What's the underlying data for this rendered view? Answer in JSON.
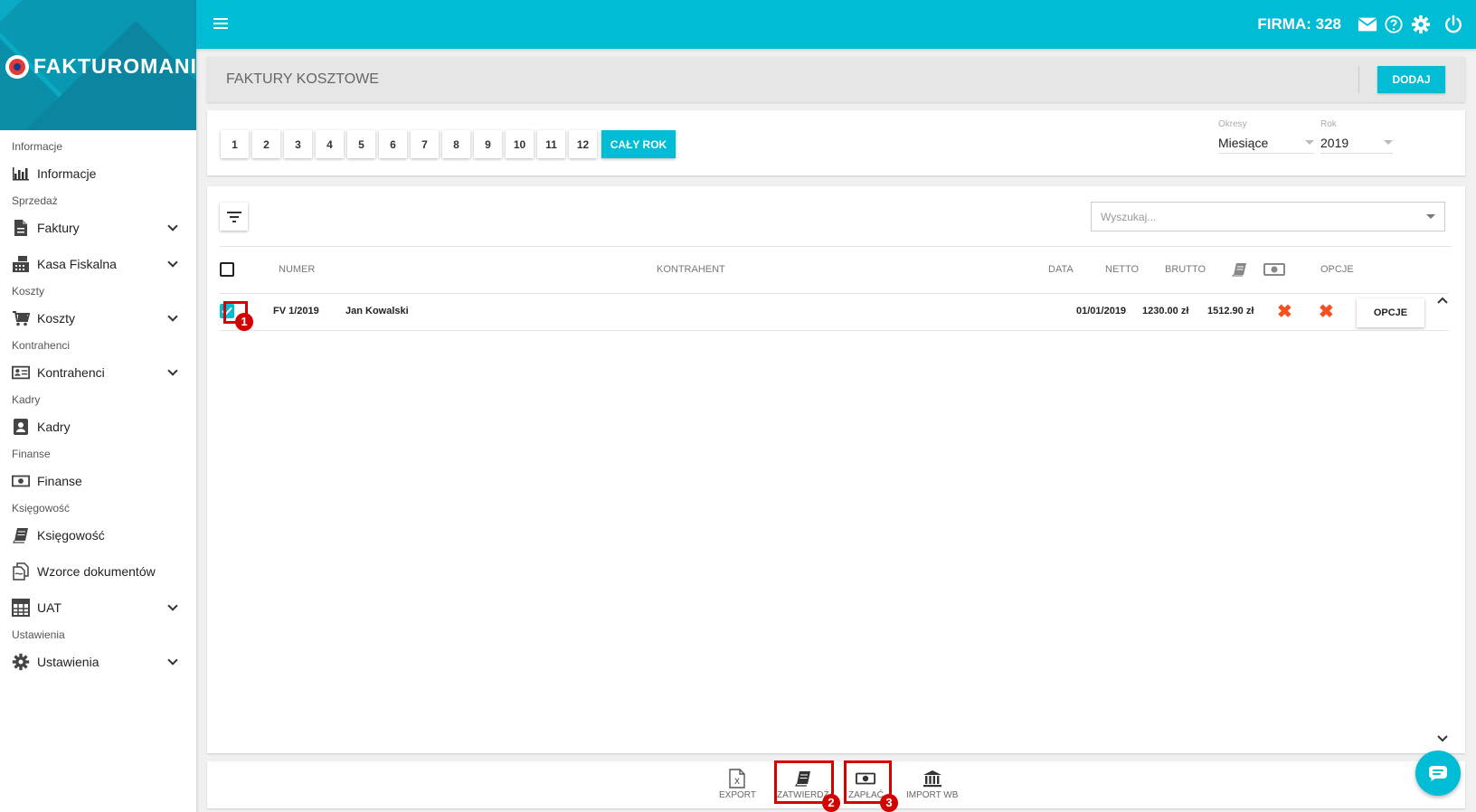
{
  "app": {
    "logo_text": "FAKTUROMANIA"
  },
  "topbar": {
    "firma_label": "FIRMA: 328"
  },
  "sidebar": {
    "items": [
      {
        "type": "section",
        "label": "Informacje"
      },
      {
        "type": "item",
        "label": "Informacje",
        "icon": "chart-bar-icon",
        "expandable": false
      },
      {
        "type": "section",
        "label": "Sprzedaż"
      },
      {
        "type": "item",
        "label": "Faktury",
        "icon": "document-icon",
        "expandable": true
      },
      {
        "type": "item",
        "label": "Kasa Fiskalna",
        "icon": "cash-register-icon",
        "expandable": true
      },
      {
        "type": "section",
        "label": "Koszty"
      },
      {
        "type": "item",
        "label": "Koszty",
        "icon": "cart-icon",
        "expandable": true
      },
      {
        "type": "section",
        "label": "Kontrahenci"
      },
      {
        "type": "item",
        "label": "Kontrahenci",
        "icon": "id-card-icon",
        "expandable": true
      },
      {
        "type": "section",
        "label": "Kadry"
      },
      {
        "type": "item",
        "label": "Kadry",
        "icon": "person-badge-icon",
        "expandable": false
      },
      {
        "type": "section",
        "label": "Finanse"
      },
      {
        "type": "item",
        "label": "Finanse",
        "icon": "money-icon",
        "expandable": false
      },
      {
        "type": "section",
        "label": "Księgowość"
      },
      {
        "type": "item",
        "label": "Księgowość",
        "icon": "ledger-book-icon",
        "expandable": false
      },
      {
        "type": "item",
        "label": "Wzorce dokumentów",
        "icon": "copy-docs-icon",
        "expandable": false
      },
      {
        "type": "item",
        "label": "UAT",
        "icon": "calculator-icon",
        "expandable": true
      },
      {
        "type": "section",
        "label": "Ustawienia"
      },
      {
        "type": "item",
        "label": "Ustawienia",
        "icon": "gear-icon",
        "expandable": true
      }
    ]
  },
  "header": {
    "title": "FAKTURY KOSZTOWE",
    "add_label": "DODAJ"
  },
  "periods": {
    "months": [
      "1",
      "2",
      "3",
      "4",
      "5",
      "6",
      "7",
      "8",
      "9",
      "10",
      "11",
      "12"
    ],
    "year_label": "CAŁY ROK",
    "okresy_label": "Okresy",
    "okresy_value": "Miesiące",
    "rok_label": "Rok",
    "rok_value": "2019"
  },
  "search": {
    "placeholder": "Wyszukaj..."
  },
  "table": {
    "headers": {
      "numer": "NUMER",
      "kontrahent": "KONTRAHENT",
      "data": "DATA",
      "netto": "NETTO",
      "brutto": "BRUTTO",
      "opcje": "OPCJE"
    },
    "rows": [
      {
        "checked": true,
        "numer": "FV 1/2019",
        "kontrahent": "Jan Kowalski",
        "data": "01/01/2019",
        "netto": "1230.00 zł",
        "brutto": "1512.90 zł",
        "zatwierdzona": false,
        "zaplacona": false,
        "opcje_label": "OPCJE"
      }
    ]
  },
  "toolbar": {
    "export_label": "EXPORT",
    "zatwierdz_label": "ZATWIERDŹ",
    "zaplac_label": "ZAPŁAĆ",
    "import_label": "IMPORT WB"
  },
  "annotations": [
    "1",
    "2",
    "3"
  ],
  "colors": {
    "accent": "#00bcd4",
    "annotation": "#d50000",
    "cross": "#f4511e"
  }
}
